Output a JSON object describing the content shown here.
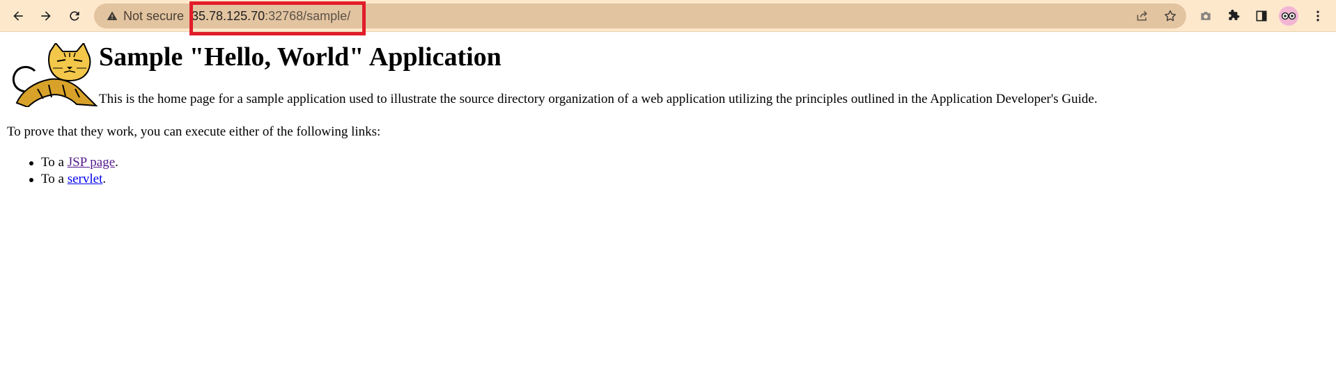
{
  "browser": {
    "security_label": "Not secure",
    "url_host": "35.78.125.70",
    "url_path": ":32768/sample/",
    "icons": [
      "back-icon",
      "forward-icon",
      "reload-icon",
      "warning-icon",
      "share-icon",
      "bookmark-star-icon",
      "camera-icon",
      "extensions-icon",
      "side-panel-icon",
      "profile-avatar-icon",
      "menu-icon"
    ],
    "colors": {
      "toolbar": "#FDE8CC",
      "omnibox": "#E3C4A0",
      "highlight": "#E11D2A"
    }
  },
  "page": {
    "title": "Sample \"Hello, World\" Application",
    "intro": "This is the home page for a sample application used to illustrate the source directory organization of a web application utilizing the principles outlined in the Application Developer's Guide.",
    "prove_text": "To prove that they work, you can execute either of the following links:",
    "links": [
      {
        "prefix": "To a ",
        "link_text": "JSP page",
        "suffix": "."
      },
      {
        "prefix": "To a ",
        "link_text": "servlet",
        "suffix": "."
      }
    ],
    "logo": "tomcat-logo-icon"
  }
}
